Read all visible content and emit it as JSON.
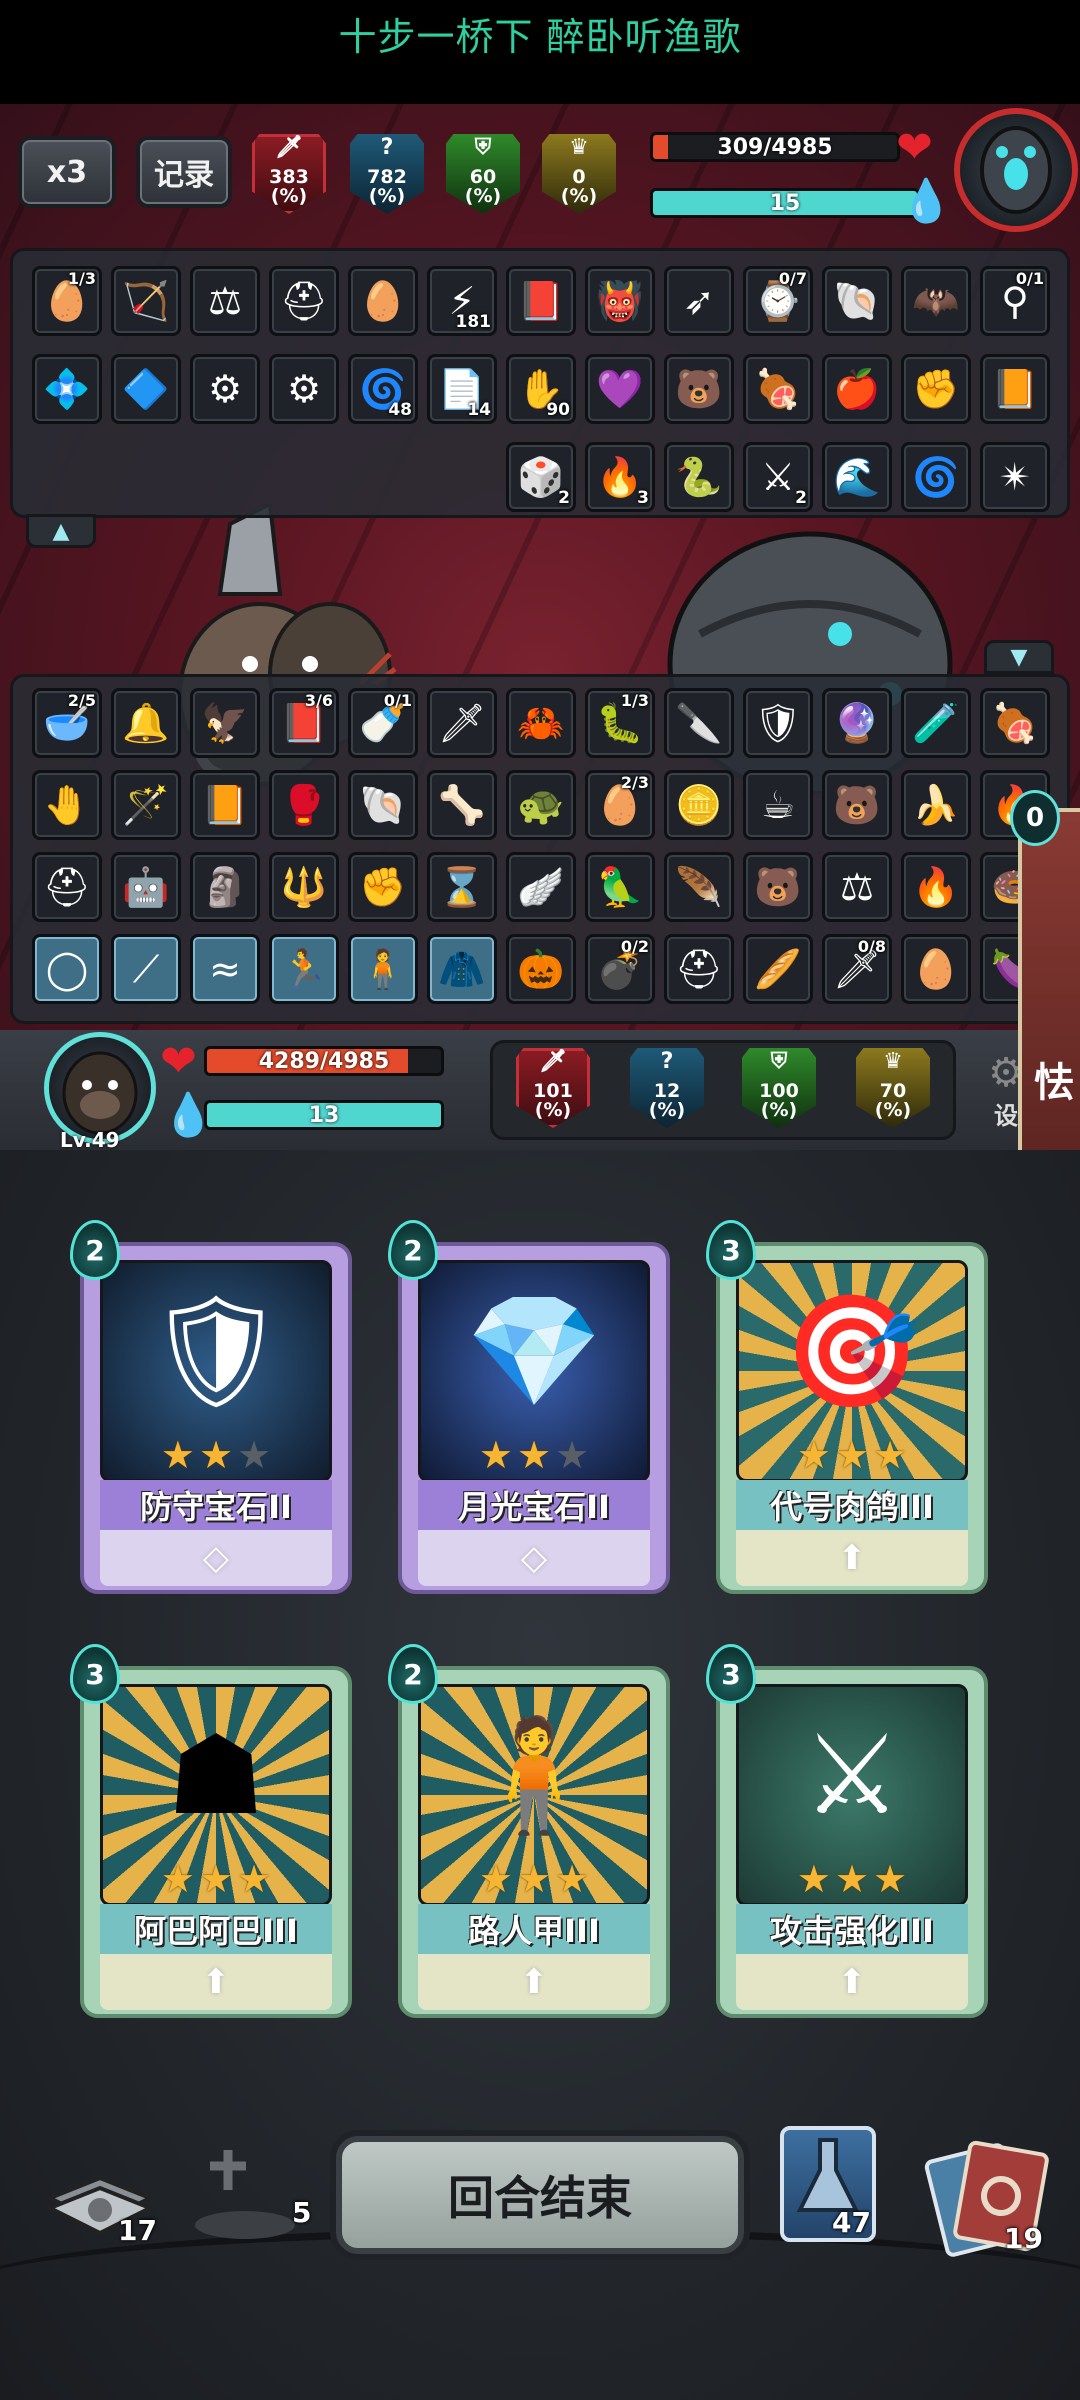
{
  "banner": {
    "text": "十步一桥下 醉卧听渔歌"
  },
  "top_bar": {
    "speed_label": "x3",
    "record_label": "记录",
    "enemy_stats": [
      {
        "value": "383",
        "unit": "(%)",
        "color": "red",
        "icon": "sword-icon"
      },
      {
        "value": "782",
        "unit": "(%)",
        "color": "blue",
        "icon": "question-icon"
      },
      {
        "value": "60",
        "unit": "(%)",
        "color": "green",
        "icon": "shield-icon"
      },
      {
        "value": "0",
        "unit": "(%)",
        "color": "yellow",
        "icon": "crown-icon"
      }
    ],
    "enemy_hp": {
      "text": "309/4985",
      "fraction": 0.062
    },
    "enemy_energy": {
      "text": "15",
      "fraction": 1.0
    }
  },
  "enemy_items_row1": [
    {
      "icon": "red-egg-icon",
      "frac": "1/3"
    },
    {
      "icon": "crossbow-icon"
    },
    {
      "icon": "scales-icon"
    },
    {
      "icon": "spartan-helmet-icon"
    },
    {
      "icon": "blue-egg-icon"
    },
    {
      "icon": "claw-slash-icon",
      "count": "181"
    },
    {
      "icon": "book-icon"
    },
    {
      "icon": "red-creature-icon"
    },
    {
      "icon": "arrows-icon"
    },
    {
      "icon": "pocket-watch-icon",
      "frac": "0/7"
    },
    {
      "icon": "dark-shell-icon"
    },
    {
      "icon": "dark-wing-icon"
    },
    {
      "icon": "amulet-icon",
      "frac": "0/1"
    }
  ],
  "enemy_items_row2": [
    {
      "icon": "blue-crystal-icon"
    },
    {
      "icon": "blue-rune-icon"
    },
    {
      "icon": "gear-plate-icon"
    },
    {
      "icon": "gear-plate-icon"
    },
    {
      "icon": "spiral-icon",
      "count": "48"
    },
    {
      "icon": "paper-icon",
      "count": "14"
    },
    {
      "icon": "purple-hand-icon",
      "count": "90"
    },
    {
      "icon": "purple-gem-icon"
    },
    {
      "icon": "brown-creature-icon"
    },
    {
      "icon": "meat-icon"
    },
    {
      "icon": "fire-fruit-icon"
    },
    {
      "icon": "fist-icon"
    },
    {
      "icon": "red-tome-icon"
    }
  ],
  "enemy_items_row3": [
    {
      "icon": "dice-icon",
      "count": "2"
    },
    {
      "icon": "fireball-icon",
      "count": "3"
    },
    {
      "icon": "green-serpent-icon"
    },
    {
      "icon": "sword-strike-icon",
      "count": "2"
    },
    {
      "icon": "blue-swirl-icon"
    },
    {
      "icon": "vortex-icon"
    },
    {
      "icon": "shatter-icon"
    }
  ],
  "player_items_row1": [
    {
      "icon": "bowl-icon",
      "frac": "2/5"
    },
    {
      "icon": "bell-icon"
    },
    {
      "icon": "claw-icon"
    },
    {
      "icon": "red-spellbook-icon",
      "frac": "3/6"
    },
    {
      "icon": "pacifier-icon",
      "frac": "0/1"
    },
    {
      "icon": "blue-sword-icon"
    },
    {
      "icon": "red-crab-icon"
    },
    {
      "icon": "green-bug-icon",
      "frac": "1/3"
    },
    {
      "icon": "dagger-icon"
    },
    {
      "icon": "armor-icon"
    },
    {
      "icon": "purple-orb-icon"
    },
    {
      "icon": "blue-tube-icon"
    },
    {
      "icon": "meat-icon"
    }
  ],
  "player_items_row2": [
    {
      "icon": "gear-hand-icon"
    },
    {
      "icon": "wand-icon"
    },
    {
      "icon": "red-tome-icon"
    },
    {
      "icon": "boxing-glove-icon"
    },
    {
      "icon": "shell-icon"
    },
    {
      "icon": "bone-icon"
    },
    {
      "icon": "spiked-turtle-icon"
    },
    {
      "icon": "red-egg-icon",
      "frac": "2/3"
    },
    {
      "icon": "blue-coin-icon"
    },
    {
      "icon": "teacup-icon"
    },
    {
      "icon": "brown-creature-icon"
    },
    {
      "icon": "banana-icon"
    },
    {
      "icon": "fire-spirit-icon"
    }
  ],
  "player_items_row3": [
    {
      "icon": "helmet-icon"
    },
    {
      "icon": "robot-cube-icon"
    },
    {
      "icon": "stone-face-icon"
    },
    {
      "icon": "spear-icon"
    },
    {
      "icon": "fist-icon"
    },
    {
      "icon": "hourglass-icon"
    },
    {
      "icon": "feather-wings-icon"
    },
    {
      "icon": "green-bird-icon"
    },
    {
      "icon": "feather-icon"
    },
    {
      "icon": "brown-creature-icon"
    },
    {
      "icon": "scales-icon"
    },
    {
      "icon": "flame-feather-icon"
    },
    {
      "icon": "donut-icon"
    }
  ],
  "player_items_row4": [
    {
      "icon": "ring-spell-icon",
      "blue": true
    },
    {
      "icon": "staff-spell-icon",
      "blue": true
    },
    {
      "icon": "wave-spell-icon",
      "blue": true
    },
    {
      "icon": "runner-spell-icon",
      "blue": true
    },
    {
      "icon": "figure-spell-icon",
      "blue": true
    },
    {
      "icon": "cloak-spell-icon",
      "blue": true
    },
    {
      "icon": "scarecrow-icon"
    },
    {
      "icon": "bomb-icon",
      "frac": "0/2"
    },
    {
      "icon": "spartan-helmet-icon"
    },
    {
      "icon": "baguette-icon"
    },
    {
      "icon": "green-blade-icon",
      "frac": "0/8"
    },
    {
      "icon": "blue-egg-icon"
    },
    {
      "icon": "eggplant-icon"
    }
  ],
  "player": {
    "level_label": "Lv.49",
    "hp": {
      "text": "4289/4985",
      "fraction": 0.86
    },
    "energy": {
      "text": "13",
      "fraction": 1.0
    },
    "stats": [
      {
        "value": "101",
        "unit": "(%)",
        "color": "red",
        "icon": "sword-icon"
      },
      {
        "value": "12",
        "unit": "(%)",
        "color": "blue",
        "icon": "question-icon"
      },
      {
        "value": "100",
        "unit": "(%)",
        "color": "green",
        "icon": "shield-icon"
      },
      {
        "value": "70",
        "unit": "(%)",
        "color": "yellow",
        "icon": "crown-icon"
      }
    ],
    "settings_label": "设",
    "side_badge": "0",
    "side_card_char": "怯"
  },
  "hand_cards": [
    {
      "cost": "2",
      "name": "防守宝石II",
      "stars": 2,
      "max_stars": 3,
      "frame": "purple",
      "art": "shield-gem-icon",
      "foot": "diamond-icon"
    },
    {
      "cost": "2",
      "name": "月光宝石II",
      "stars": 2,
      "max_stars": 3,
      "frame": "purple",
      "art": "moon-gem-icon",
      "foot": "diamond-icon"
    },
    {
      "cost": "3",
      "name": "代号肉鸽III",
      "stars": 3,
      "max_stars": 3,
      "frame": "green",
      "art": "target-tablet-icon",
      "foot": "arrow-up-icon"
    },
    {
      "cost": "3",
      "name": "阿巴阿巴III",
      "stars": 3,
      "max_stars": 3,
      "frame": "green",
      "art": "silhouette-blob-icon",
      "foot": "arrow-up-icon"
    },
    {
      "cost": "2",
      "name": "路人甲III",
      "stars": 3,
      "max_stars": 3,
      "frame": "green",
      "art": "silhouette-person-icon",
      "foot": "arrow-up-icon"
    },
    {
      "cost": "3",
      "name": "攻击强化III",
      "stars": 3,
      "max_stars": 3,
      "frame": "green",
      "art": "sword-swirl-icon",
      "foot": "arrow-up-icon"
    }
  ],
  "bottom_bar": {
    "draw_pile_count": "17",
    "grave_count": "5",
    "end_turn_label": "回合结束",
    "potion_count": "47",
    "discard_pile_count": "19"
  },
  "colors": {
    "accent_teal": "#52e2d6",
    "hp_red": "#e34b2a",
    "energy_teal": "#4fd6cf",
    "banner_green": "#2fd0a0"
  }
}
